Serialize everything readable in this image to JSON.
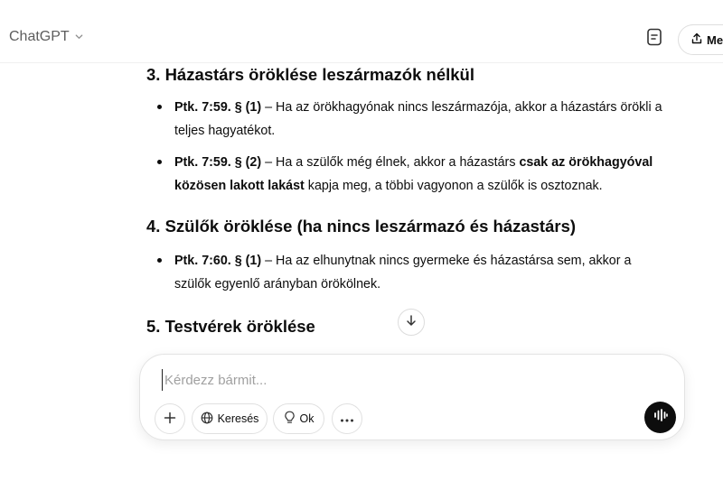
{
  "header": {
    "model_name": "ChatGPT",
    "share_label": "Me"
  },
  "content": {
    "sections": [
      {
        "title": "3. Házastárs öröklése leszármazók nélkül"
      },
      {
        "title": "4. Szülők öröklése (ha nincs leszármazó és házastárs)"
      },
      {
        "title": "5. Testvérek öröklése"
      }
    ],
    "s3_items": [
      {
        "ref": "Ptk. 7:59. § (1)",
        "text": " – Ha az örökhagyónak nincs leszármazója, akkor a házastárs örökli a teljes hagyatékot."
      },
      {
        "ref": "Ptk. 7:59. § (2)",
        "text_before": " – Ha a szülők még élnek, akkor a házastárs ",
        "bold": "csak az örökhagyóval közösen lakott lakást",
        "text_after": " kapja meg, a többi vagyonon a szülők is osztoznak."
      }
    ],
    "s4_items": [
      {
        "ref": "Ptk. 7:60. § (1)",
        "text": " – Ha az elhunytnak nincs gyermeke és házastársa sem, akkor a szülők egyenlő arányban örökölnek."
      }
    ]
  },
  "composer": {
    "placeholder": "Kérdezz bármit...",
    "value": "",
    "search_label": "Keresés",
    "reason_label": "Ok"
  },
  "icons": {
    "chevron": "chevron-down-icon",
    "canvas": "canvas-icon",
    "share": "share-icon",
    "scroll": "arrow-down-icon",
    "plus": "plus-icon",
    "globe": "globe-icon",
    "bulb": "lightbulb-icon",
    "more": "ellipsis-icon",
    "voice": "voice-waveform-icon"
  },
  "colors": {
    "text": "#0d0d0d",
    "muted": "#5d5d5d",
    "placeholder": "#a0a0a0",
    "border": "#e3e3e3",
    "voice_bg": "#0d0d0d"
  }
}
